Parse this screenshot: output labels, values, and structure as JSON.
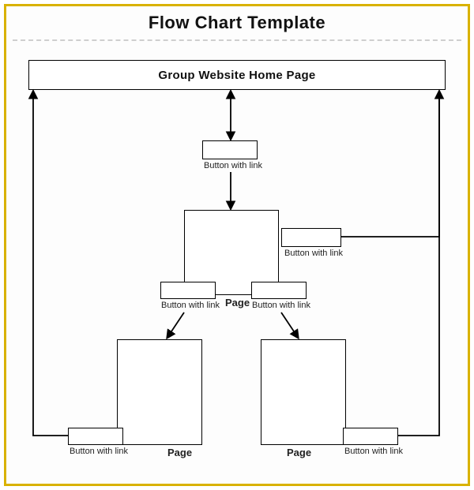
{
  "title": "Flow Chart Template",
  "home_label": "Group Website Home Page",
  "labels": {
    "btn1": "Button with link",
    "btn_topright": "Button with link",
    "btn_left_mid": "Button with link",
    "btn_right_mid": "Button with link",
    "btn_left_bottom": "Button with link",
    "btn_right_bottom": "Button with link",
    "page_mid": "Page",
    "page_left": "Page",
    "page_right": "Page"
  },
  "chart_data": {
    "type": "flow",
    "title": "Flow Chart Template",
    "nodes": [
      {
        "id": "home",
        "type": "page",
        "label": "Group Website Home Page"
      },
      {
        "id": "btn1",
        "type": "button",
        "label": "Button with link"
      },
      {
        "id": "pageA",
        "type": "page",
        "label": "Page"
      },
      {
        "id": "btnA_top",
        "type": "button",
        "label": "Button with link"
      },
      {
        "id": "btnA_left",
        "type": "button",
        "label": "Button with link"
      },
      {
        "id": "btnA_right",
        "type": "button",
        "label": "Button with link"
      },
      {
        "id": "pageB_left",
        "type": "page",
        "label": "Page"
      },
      {
        "id": "pageB_right",
        "type": "page",
        "label": "Page"
      },
      {
        "id": "btnB_left",
        "type": "button",
        "label": "Button with link"
      },
      {
        "id": "btnB_right",
        "type": "button",
        "label": "Button with link"
      }
    ],
    "edges": [
      {
        "from": "home",
        "to": "btn1",
        "bidir": true
      },
      {
        "from": "btn1",
        "to": "pageA"
      },
      {
        "from": "pageA",
        "to": "btnA_top",
        "side": "right"
      },
      {
        "from": "btnA_top",
        "to": "home",
        "route": "right"
      },
      {
        "from": "pageA",
        "to": "btnA_left",
        "side": "bottom-left"
      },
      {
        "from": "pageA",
        "to": "btnA_right",
        "side": "bottom-right"
      },
      {
        "from": "btnA_left",
        "to": "pageB_left"
      },
      {
        "from": "btnA_right",
        "to": "pageB_right"
      },
      {
        "from": "pageB_left",
        "to": "btnB_left",
        "side": "bottom-left"
      },
      {
        "from": "pageB_right",
        "to": "btnB_right",
        "side": "bottom-right"
      },
      {
        "from": "btnB_left",
        "to": "home",
        "route": "left"
      },
      {
        "from": "btnB_right",
        "to": "home",
        "route": "right"
      }
    ]
  }
}
